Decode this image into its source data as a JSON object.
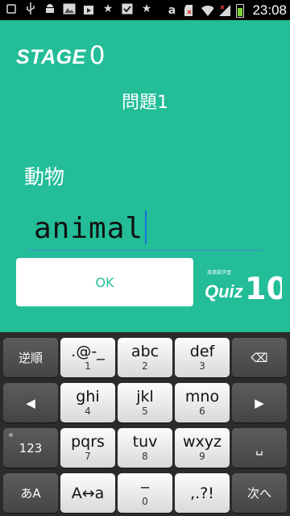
{
  "status_bar": {
    "left_icons": [
      "notification-icon",
      "usb-icon",
      "android-icon",
      "image-icon",
      "play-store-icon",
      "star-icon",
      "check-icon",
      "star-icon"
    ],
    "right_icons": [
      "amazon-icon",
      "sd-card-icon",
      "wifi-icon",
      "signal-icon",
      "battery-icon"
    ],
    "amazon_glyph": "a",
    "time": "23:08"
  },
  "app": {
    "background": "#23bd98",
    "stage_word": "STAGE",
    "stage_number": "0",
    "question_number": "問題1",
    "hint_word": "動物",
    "answer_value": "animal",
    "ok_label": "OK",
    "logo": {
      "small_text": "英単語学習",
      "quiz_text": "Quiz",
      "number_text": "10"
    }
  },
  "keyboard": {
    "rows": [
      [
        {
          "name": "key-reverse",
          "main": "逆順",
          "sub": "",
          "style": "dark"
        },
        {
          "name": "key-symbols-1",
          "main": ".@-_",
          "sub": "1",
          "style": "light"
        },
        {
          "name": "key-abc-2",
          "main": "abc",
          "sub": "2",
          "style": "light"
        },
        {
          "name": "key-def-3",
          "main": "def",
          "sub": "3",
          "style": "light"
        },
        {
          "name": "key-backspace",
          "main": "⌫",
          "sub": "",
          "style": "dark"
        }
      ],
      [
        {
          "name": "key-cursor-left",
          "main": "◀",
          "sub": "",
          "style": "dark"
        },
        {
          "name": "key-ghi-4",
          "main": "ghi",
          "sub": "4",
          "style": "light"
        },
        {
          "name": "key-jkl-5",
          "main": "jkl",
          "sub": "5",
          "style": "light"
        },
        {
          "name": "key-mno-6",
          "main": "mno",
          "sub": "6",
          "style": "light"
        },
        {
          "name": "key-cursor-right",
          "main": "▶",
          "sub": "",
          "style": "dark"
        }
      ],
      [
        {
          "name": "key-123-mode",
          "main": "123",
          "sub": "",
          "style": "dark"
        },
        {
          "name": "key-pqrs-7",
          "main": "pqrs",
          "sub": "7",
          "style": "light"
        },
        {
          "name": "key-tuv-8",
          "main": "tuv",
          "sub": "8",
          "style": "light"
        },
        {
          "name": "key-wxyz-9",
          "main": "wxyz",
          "sub": "9",
          "style": "light"
        },
        {
          "name": "key-space",
          "main": "␣",
          "sub": "",
          "style": "dark"
        }
      ],
      [
        {
          "name": "key-input-mode",
          "main": "あA",
          "sub": "",
          "style": "dark"
        },
        {
          "name": "key-case-toggle",
          "main": "A↔a",
          "sub": "",
          "style": "light"
        },
        {
          "name": "key-dash-0",
          "main": "‒",
          "sub": "0",
          "style": "light"
        },
        {
          "name": "key-punctuation",
          "main": ",.?!",
          "sub": "",
          "style": "light"
        },
        {
          "name": "key-next",
          "main": "次へ",
          "sub": "",
          "style": "dark"
        }
      ]
    ]
  }
}
